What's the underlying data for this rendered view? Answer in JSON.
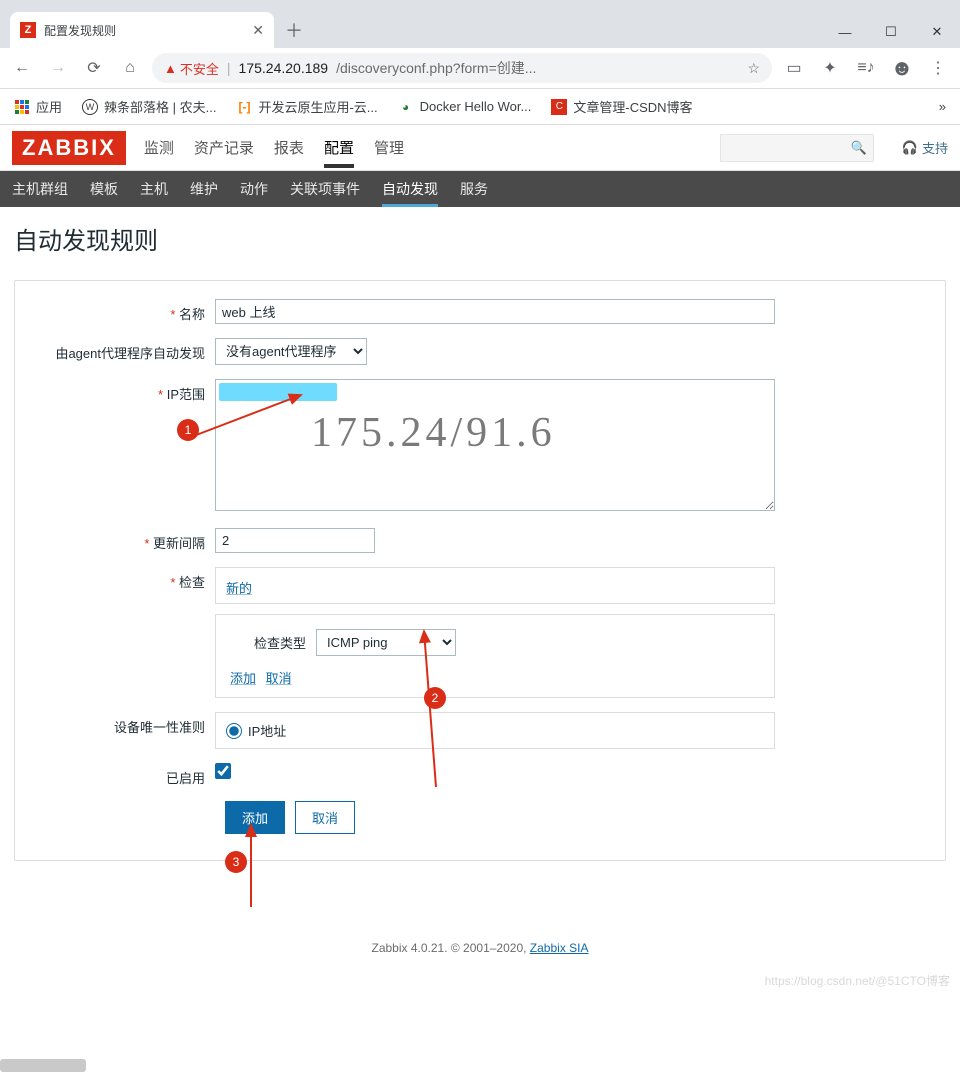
{
  "browser": {
    "tab_title": "配置发现规则",
    "url_warning": "不安全",
    "url_host": "175.24.20.189",
    "url_path": "/discoveryconf.php?form=创建...",
    "bookmarks": {
      "apps": "应用",
      "b1": "辣条部落格 | 农夫...",
      "b2": "开发云原生应用-云...",
      "b3": "Docker Hello Wor...",
      "b4": "文章管理-CSDN博客"
    }
  },
  "zabbix": {
    "logo": "ZABBIX",
    "topnav": [
      "监测",
      "资产记录",
      "报表",
      "配置",
      "管理"
    ],
    "topnav_active": "配置",
    "subnav": [
      "主机群组",
      "模板",
      "主机",
      "维护",
      "动作",
      "关联项事件",
      "自动发现",
      "服务"
    ],
    "subnav_active": "自动发现",
    "support": "支持"
  },
  "page": {
    "title": "自动发现规则"
  },
  "form": {
    "labels": {
      "name": "名称",
      "agent": "由agent代理程序自动发现",
      "iprange": "IP范围",
      "interval": "更新间隔",
      "checks": "检查",
      "checktype": "检查类型",
      "uniqueness": "设备唯一性准则",
      "enabled": "已启用"
    },
    "values": {
      "name": "web 上线",
      "agent_option": "没有agent代理程序",
      "interval": "2",
      "check_new": "新的",
      "checktype_option": "ICMP ping",
      "inner_add": "添加",
      "inner_cancel": "取消",
      "uniqueness_option": "IP地址",
      "submit": "添加",
      "cancel": "取消"
    }
  },
  "annotations": {
    "badge1": "1",
    "badge2": "2",
    "badge3": "3",
    "handwritten_ip": "175.24/91.6"
  },
  "footer": {
    "text_a": "Zabbix 4.0.21. © 2001–2020, ",
    "link": "Zabbix SIA",
    "watermark": "https://blog.csdn.net/@51CTO博客"
  }
}
